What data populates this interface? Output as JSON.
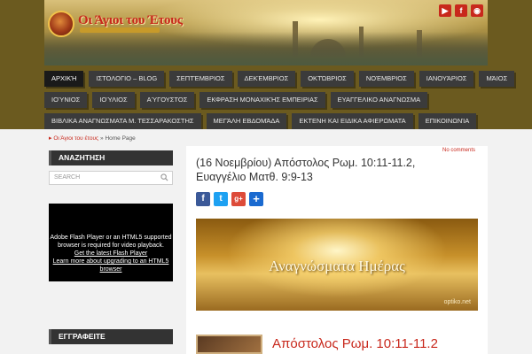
{
  "site": {
    "title": "Οι Άγιοι του Έτους",
    "social": [
      {
        "name": "youtube",
        "glyph": "▶",
        "color": "#c8281c"
      },
      {
        "name": "facebook",
        "glyph": "f",
        "color": "#c8281c"
      },
      {
        "name": "rss",
        "glyph": "◉",
        "color": "#c8281c"
      }
    ]
  },
  "nav": {
    "row1": [
      "ΑΡΧΙΚΉ",
      "ΙΣΤΟΛΟΓΙΟ – BLOG",
      "ΣΕΠΤΈΜΒΡΙΟΣ",
      "ΔΕΚΈΜΒΡΙΟΣ",
      "ΟΚΤΏΒΡΙΟΣ",
      "ΝΟΈΜΒΡΙΟΣ",
      "ΙΑΝΟΥΆΡΙΟΣ",
      "ΜΆΙΟΣ"
    ],
    "row2": [
      "ΙΟΎΝΙΟΣ",
      "ΙΟΎΛΙΟΣ",
      "ΑΎΓΟΥΣΤΟΣ",
      "ΕΚΦΡΑΣΗ ΜΟΝΑΧΙΚΉΣ ΕΜΠΕΙΡΙΑΣ",
      "ΕΥΑΓΓΕΛΙΚΟ ΑΝΑΓΝΩΣΜΑ"
    ],
    "row3": [
      "ΒΙΒΛΙΚΑ ΑΝΑΓΝΩΣΜΑΤΑ Μ. ΤΕΣΣΑΡΑΚΟΣΤΗΣ",
      "ΜΕΓΆΛΗ ΕΒΔΟΜΆΔΑ",
      "ΕΚΤΕΝΗ ΚΑΙ ΕΙΔΙΚΑ ΑΦΙΕΡΩΜΑΤΑ",
      "ΕΠΙΚΟΙΝΩΝΊΑ"
    ]
  },
  "breadcrumb": {
    "arrow": "▸",
    "home": "Οι Άγιοι του έτους",
    "sep": "»",
    "current": "Home Page"
  },
  "sidebar": {
    "search_heading": "ΑΝΑΖΗΤΗΣΗ",
    "search_placeholder": "SEARCH",
    "flash_line1": "Adobe Flash Player or an HTML5 supported browser is required for video playback.",
    "flash_link1": "Get the latest Flash Player",
    "flash_link2": "Learn more about upgrading to an HTML5 browser",
    "subscribe_heading": "ΕΓΓΡΑΦΕΙΤΕ"
  },
  "post": {
    "comments": "No comments",
    "title": "(16 Νοεμβρίου) Απόστολος Ρωμ. 10:11-11.2, Ευαγγέλιο Ματθ. 9:9-13",
    "share": [
      {
        "name": "facebook",
        "glyph": "f",
        "color": "#3b5998"
      },
      {
        "name": "twitter",
        "glyph": "t",
        "color": "#1da1f2"
      },
      {
        "name": "googleplus",
        "glyph": "g+",
        "color": "#dd4b39"
      },
      {
        "name": "share",
        "glyph": "+",
        "color": "#1a6ad0"
      }
    ],
    "banner_text": "Αναγνώσματα Ημέρας",
    "banner_watermark": "optiko.net",
    "reading_title": "Απόστολος Ρωμ. 10:11-11.2"
  }
}
